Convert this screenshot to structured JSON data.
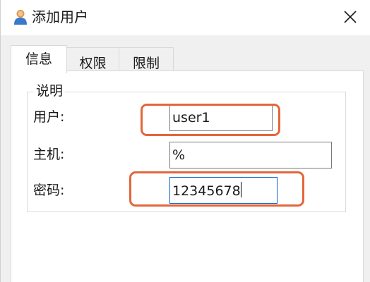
{
  "window": {
    "title": "添加用户",
    "icon": "user-icon",
    "close_icon": "close-icon"
  },
  "tabs": [
    {
      "label": "信息",
      "active": true
    },
    {
      "label": "权限",
      "active": false
    },
    {
      "label": "限制",
      "active": false
    }
  ],
  "info_group": {
    "title": "说明",
    "fields": {
      "user": {
        "label": "用户:",
        "value": "user1"
      },
      "host": {
        "label": "主机:",
        "value": "%"
      },
      "password": {
        "label": "密码:",
        "value": "12345678",
        "focused": true
      }
    }
  },
  "colors": {
    "annotation": "#e3663a",
    "focus_border": "#0a64c8",
    "client_bg": "#f0f0f0"
  }
}
